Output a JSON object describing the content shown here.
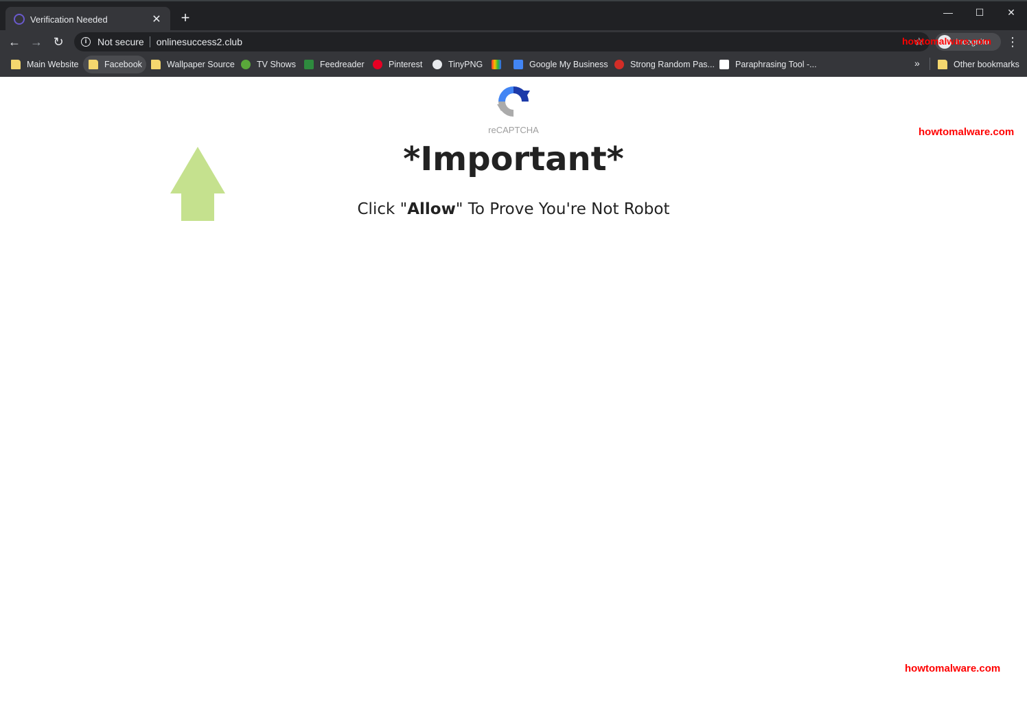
{
  "browser": {
    "tab_title": "Verification Needed",
    "new_tab": "+",
    "security_label": "Not secure",
    "url": "onlinesuccess2.club",
    "profile_label": "Incognito"
  },
  "bookmarks": [
    {
      "label": "Main Website",
      "icon": "folder-icon"
    },
    {
      "label": "Facebook",
      "icon": "folder-icon"
    },
    {
      "label": "Wallpaper Source",
      "icon": "folder-icon"
    },
    {
      "label": "TV Shows",
      "icon": "play-icon"
    },
    {
      "label": "Feedreader",
      "icon": "feedreader-icon"
    },
    {
      "label": "Pinterest",
      "icon": "pinterest-icon"
    },
    {
      "label": "TinyPNG",
      "icon": "panda-icon"
    },
    {
      "label": "",
      "icon": "colorful-icon"
    },
    {
      "label": "Google My Business",
      "icon": "google-my-business-icon"
    },
    {
      "label": "Strong Random Pas...",
      "icon": "lastpass-icon"
    },
    {
      "label": "Paraphrasing Tool -...",
      "icon": "paraphrase-icon"
    },
    {
      "label": "Other bookmarks",
      "icon": "folder-icon"
    }
  ],
  "page": {
    "captcha_label": "reCAPTCHA",
    "heading": "*Important*",
    "sub_before": "Click \"",
    "sub_bold": "Allow",
    "sub_after": "\" To Prove You're Not Robot"
  },
  "watermark": "howtomalware.com",
  "colors": {
    "arrow": "#c5e18e",
    "watermark": "#ff0000",
    "chrome_dark": "#202124",
    "chrome_toolbar": "#35363a"
  }
}
